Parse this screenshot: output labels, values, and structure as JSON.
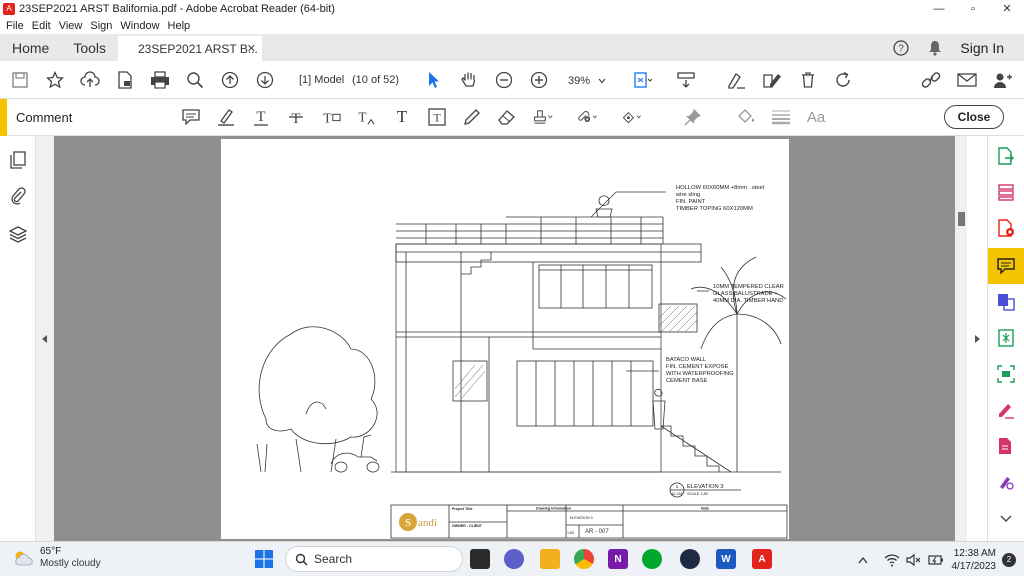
{
  "window": {
    "title": "23SEP2021 ARST Balifornia.pdf - Adobe Acrobat Reader (64-bit)",
    "minimize": "—",
    "maximize": "▫",
    "close": "✕"
  },
  "menu": [
    "File",
    "Edit",
    "View",
    "Sign",
    "Window",
    "Help"
  ],
  "tabs": {
    "home": "Home",
    "tools": "Tools",
    "document": "23SEP2021 ARST B...",
    "doc_close": "✕",
    "signin": "Sign In"
  },
  "toolbar": {
    "page_label": "[1] Model",
    "page_count": "(10 of 52)",
    "zoom": "39%"
  },
  "comment_bar": {
    "label": "Comment",
    "close_label": "Close",
    "text_tool": "T",
    "font_tool": "Aa"
  },
  "drawing": {
    "note_railing": [
      "HOLLOW 60X60MM +8mm . steel",
      "wire sling",
      "FIN. PAINT",
      "TIMBER TOPING 60X120MM"
    ],
    "note_glass": [
      "10MM TEMPERED CLEAR",
      "GLASS BALUSTRADE +",
      "40MM DIA. TIMBER HAND"
    ],
    "note_wall": [
      "BATACO WALL",
      "FIN. CEMENT EXPOSE",
      "WITH WATERPROOFING",
      "CEMENT BASE"
    ],
    "elevation_number": "1",
    "elevation_sheet": "A1-002",
    "elevation_title": "ELEVATION 3",
    "elevation_scale": "SCALE 1:80",
    "titleblock": {
      "logo_letter": "S",
      "logo_text": "andi",
      "project_title": "Project Title",
      "owner": "OWNER - CLIENT",
      "drawing_info": "Drawing Information",
      "drawing_name": "ELEVATION 3",
      "sheet_no": "AR - 007",
      "note": "Note",
      "scale": "1:80"
    }
  },
  "taskbar": {
    "temperature": "65°F",
    "condition": "Mostly cloudy",
    "search_label": "Search",
    "time": "12:38 AM",
    "date": "4/17/2023",
    "notifications": "2"
  },
  "colors": {
    "accent": "#f5c400",
    "acrobat_red": "#e2231a",
    "doc_background": "#8f8f8f"
  }
}
